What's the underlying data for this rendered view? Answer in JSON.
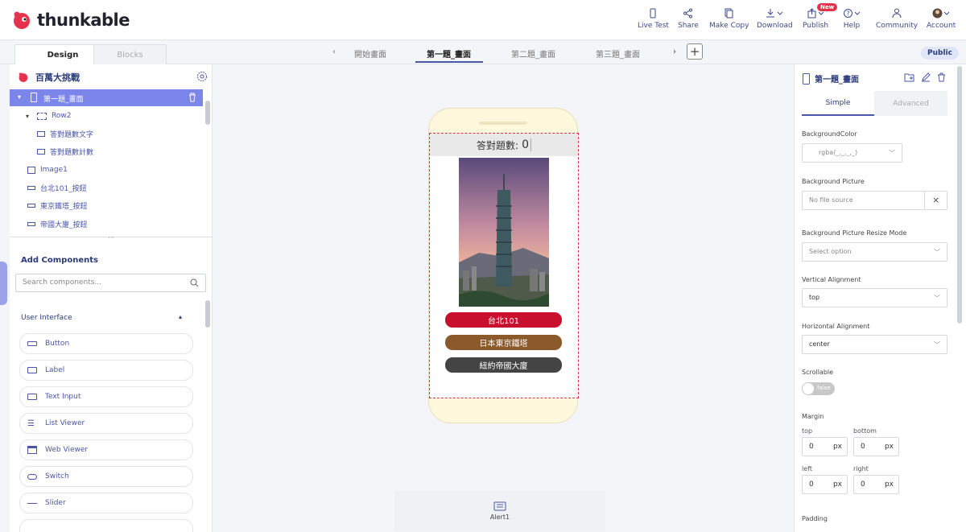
{
  "brand": {
    "name": "thunkable"
  },
  "nav": {
    "live_test": "Live Test",
    "share": "Share",
    "make_copy": "Make Copy",
    "download": "Download",
    "publish": "Publish",
    "publish_badge": "New",
    "help": "Help",
    "community": "Community",
    "account": "Account"
  },
  "editor_tabs": {
    "design": "Design",
    "blocks": "Blocks"
  },
  "screens": [
    "開始畫面",
    "第一題_畫面",
    "第二題_畫面",
    "第三題_畫面"
  ],
  "visibility": "Public",
  "tree": {
    "project": "百萬大挑戰",
    "items": [
      "第一題_畫面",
      "Row2",
      "答對題數文字",
      "答對題數計數",
      "Image1",
      "台北101_按鈕",
      "東京鐵塔_按鈕",
      "帝國大廈_按鈕"
    ]
  },
  "components": {
    "title": "Add Components",
    "search_placeholder": "Search components...",
    "section": "User Interface",
    "items": [
      "Button",
      "Label",
      "Text Input",
      "List Viewer",
      "Web Viewer",
      "Switch",
      "Slider"
    ]
  },
  "phone": {
    "counter_label": "答對題數:",
    "counter_value": "0",
    "buttons": [
      {
        "label": "台北101",
        "color": "#c8102e"
      },
      {
        "label": "日本東京鐵塔",
        "color": "#8b5a2b"
      },
      {
        "label": "紐約帝國大廈",
        "color": "#444444"
      }
    ]
  },
  "alert": "Alert1",
  "props": {
    "title": "第一題_畫面",
    "tab_simple": "Simple",
    "tab_advanced": "Advanced",
    "background_color_label": "BackgroundColor",
    "background_color_value": "rgba(_,_,_,_)",
    "background_picture_label": "Background Picture",
    "background_picture_value": "No file source",
    "resize_mode_label": "Background Picture Resize Mode",
    "resize_mode_value": "Select option",
    "vertical_label": "Vertical Alignment",
    "vertical_value": "top",
    "horizontal_label": "Horizontal Alignment",
    "horizontal_value": "center",
    "scrollable_label": "Scrollable",
    "scrollable_value": "false",
    "margin_label": "Margin",
    "margin": {
      "top": "top",
      "bottom": "bottom",
      "left": "left",
      "right": "right",
      "value": "0",
      "unit": "px"
    },
    "padding_label": "Padding"
  },
  "colors": {
    "accent": "#4a56a8",
    "selection": "#7c86ea",
    "brand_red": "#e8314c"
  }
}
